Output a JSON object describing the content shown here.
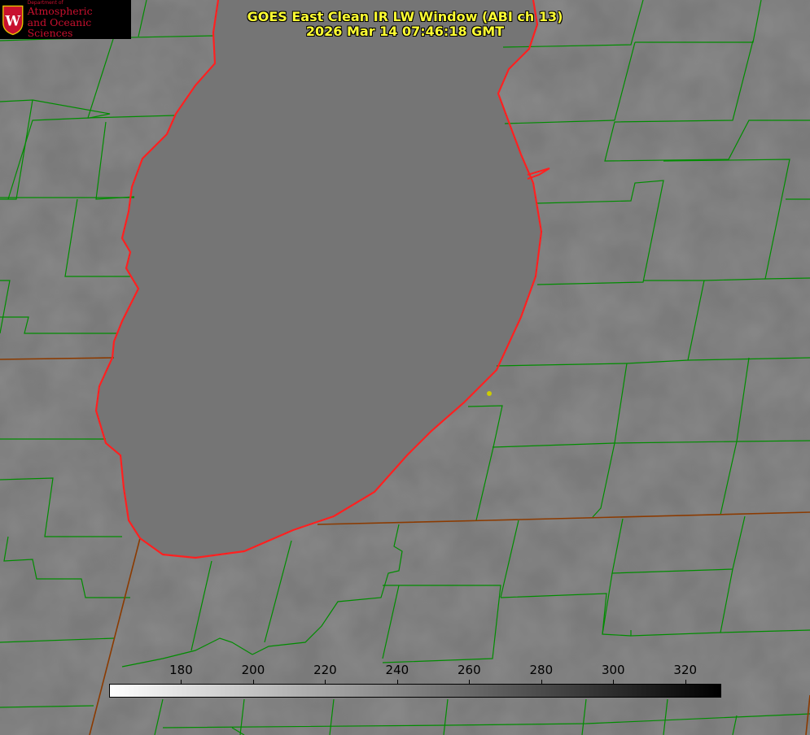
{
  "header": {
    "title": "GOES East Clean IR LW Window (ABI ch 13)",
    "timestamp": "2026 Mar 14 07:46:18 GMT"
  },
  "logo": {
    "department": "Department of",
    "name_line1": "Atmospheric",
    "name_line2": "and Oceanic Sciences",
    "crest_letter": "W"
  },
  "colorbar": {
    "min": 160,
    "max": 330,
    "ticks": [
      "180",
      "200",
      "220",
      "240",
      "260",
      "280",
      "300",
      "320"
    ],
    "colors": {
      "warm": "#ffffff",
      "cold": "#000000"
    }
  },
  "map": {
    "background": "#7b7b7b",
    "lake_color": "#737373",
    "county_line_color": "#008c00",
    "shoreline_color": "#ff2020",
    "state_line_color": "#8b3a00",
    "marker_color": "#cccc00"
  }
}
